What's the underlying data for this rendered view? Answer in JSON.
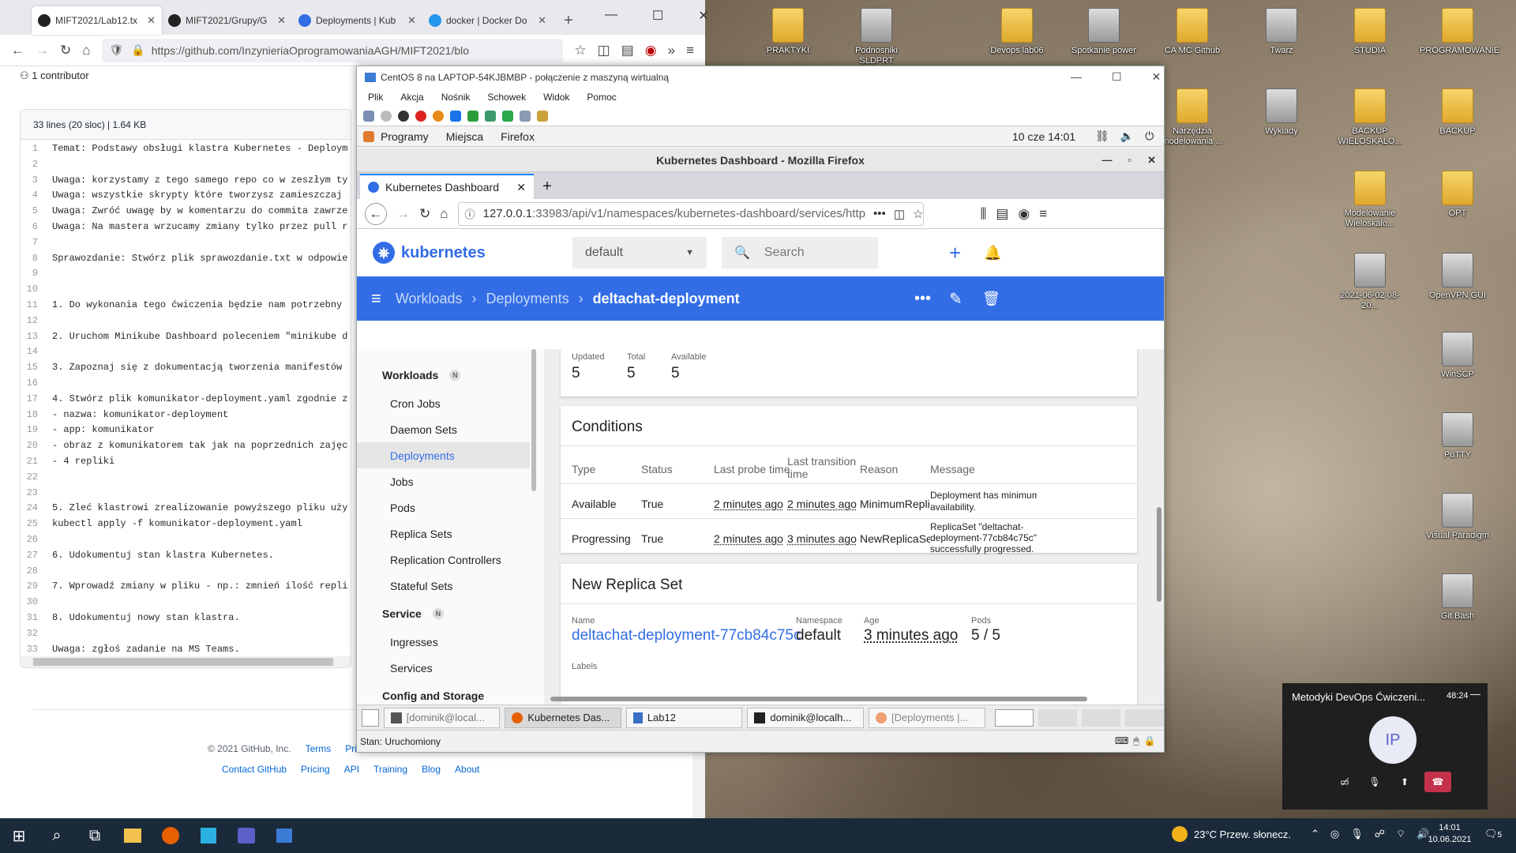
{
  "host_browser": {
    "tabs": [
      "MIFT2021/Lab12.tx",
      "MIFT2021/Grupy/G",
      "Deployments | Kub",
      "docker | Docker Do"
    ],
    "url": "https://github.com/InzynieriaOprogramowaniaAGH/MIFT2021/blo",
    "contributors": "1 contributor",
    "file_info": "33 lines (20 sloc)  |  1.64 KB",
    "lines": [
      {
        "n": "1",
        "t": "Temat: Podstawy obsługi klastra Kubernetes - Deploym"
      },
      {
        "n": "2",
        "t": ""
      },
      {
        "n": "3",
        "t": "Uwaga: korzystamy z tego samego repo co w zeszłym ty"
      },
      {
        "n": "4",
        "t": "Uwaga: wszystkie skrypty które tworzysz zamieszczaj"
      },
      {
        "n": "5",
        "t": "Uwaga: Zwróć uwagę by w komentarzu do commita zawrze"
      },
      {
        "n": "6",
        "t": "Uwaga: Na mastera wrzucamy zmiany tylko przez pull r"
      },
      {
        "n": "7",
        "t": ""
      },
      {
        "n": "8",
        "t": "Sprawozdanie: Stwórz plik sprawozdanie.txt w odpowie"
      },
      {
        "n": "9",
        "t": ""
      },
      {
        "n": "10",
        "t": ""
      },
      {
        "n": "11",
        "t": "1. Do wykonania tego ćwiczenia będzie nam potrzebny"
      },
      {
        "n": "12",
        "t": ""
      },
      {
        "n": "13",
        "t": "2. Uruchom Minikube Dashboard poleceniem \"minikube d"
      },
      {
        "n": "14",
        "t": ""
      },
      {
        "n": "15",
        "t": "3. Zapoznaj się z dokumentacją tworzenia manifestów"
      },
      {
        "n": "16",
        "t": ""
      },
      {
        "n": "17",
        "t": "4. Stwórz plik komunikator-deployment.yaml zgodnie z"
      },
      {
        "n": "18",
        "t": "- nazwa: komunikator-deployment"
      },
      {
        "n": "19",
        "t": "- app: komunikator"
      },
      {
        "n": "20",
        "t": "- obraz z komunikatorem tak jak na poprzednich zajęc"
      },
      {
        "n": "21",
        "t": "- 4 repliki"
      },
      {
        "n": "22",
        "t": ""
      },
      {
        "n": "23",
        "t": ""
      },
      {
        "n": "24",
        "t": "5. Zleć klastrowi zrealizowanie powyższego pliku uży"
      },
      {
        "n": "25",
        "t": "kubectl apply -f komunikator-deployment.yaml"
      },
      {
        "n": "26",
        "t": ""
      },
      {
        "n": "27",
        "t": "6. Udokumentuj stan klastra Kubernetes."
      },
      {
        "n": "28",
        "t": ""
      },
      {
        "n": "29",
        "t": "7. Wprowadź zmiany w pliku - np.: zmnień ilość repli"
      },
      {
        "n": "30",
        "t": ""
      },
      {
        "n": "31",
        "t": "8. Udokumentuj nowy stan klastra."
      },
      {
        "n": "32",
        "t": ""
      },
      {
        "n": "33",
        "t": "Uwaga: zgłoś zadanie na MS Teams."
      }
    ],
    "footer_copy": "© 2021 GitHub, Inc.",
    "footer_terms": "Terms",
    "footer_priv": "Priv",
    "footer_links": [
      "Contact GitHub",
      "Pricing",
      "API",
      "Training",
      "Blog",
      "About"
    ]
  },
  "vm": {
    "title": "CentOS 8 na LAPTOP-54KJBMBP - połączenie z maszyną wirtualną",
    "menu": [
      "Plik",
      "Akcja",
      "Nośnik",
      "Schowek",
      "Widok",
      "Pomoc"
    ],
    "gnome": {
      "items": [
        "Programy",
        "Miejsca",
        "Firefox"
      ],
      "clock": "10 cze  14:01"
    },
    "status": "Stan: Uruchomiony",
    "tasks": [
      "[dominik@local...",
      "Kubernetes Das...",
      "Lab12",
      "dominik@localh...",
      "[Deployments |..."
    ]
  },
  "guest_firefox": {
    "title": "Kubernetes Dashboard - Mozilla Firefox",
    "tab": "Kubernetes Dashboard",
    "url_host": "127.0.0.1",
    "url_rest": ":33983/api/v1/namespaces/kubernetes-dashboard/services/http"
  },
  "k8s": {
    "brand": "kubernetes",
    "namespace": "default",
    "search_placeholder": "Search",
    "breadcrumb": [
      "Workloads",
      "Deployments",
      "deltachat-deployment"
    ],
    "sidebar": {
      "workloads_hdr": "Workloads",
      "badge": "N",
      "workloads": [
        "Cron Jobs",
        "Daemon Sets",
        "Deployments",
        "Jobs",
        "Pods",
        "Replica Sets",
        "Replication Controllers",
        "Stateful Sets"
      ],
      "service_hdr": "Service",
      "service": [
        "Ingresses",
        "Services"
      ],
      "config_hdr": "Config and Storage"
    },
    "status": {
      "updated_lbl": "Updated",
      "updated": "5",
      "total_lbl": "Total",
      "total": "5",
      "available_lbl": "Available",
      "available": "5"
    },
    "conditions": {
      "title": "Conditions",
      "headers": {
        "type": "Type",
        "status": "Status",
        "probe": "Last probe time",
        "trans1": "Last transition",
        "trans2": "time",
        "reason": "Reason",
        "message": "Message"
      },
      "rows": [
        {
          "type": "Available",
          "status": "True",
          "probe": "2 minutes ago",
          "trans": "2 minutes ago",
          "reason": "MinimumReplicas",
          "msg1": "Deployment has minimum",
          "msg2": "availability.",
          "msg3": ""
        },
        {
          "type": "Progressing",
          "status": "True",
          "probe": "2 minutes ago",
          "trans": "3 minutes ago",
          "reason": "NewReplicaSetAv",
          "msg1": "ReplicaSet \"deltachat-",
          "msg2": "deployment-77cb84c75c\"",
          "msg3": "successfully progressed."
        }
      ]
    },
    "replica": {
      "title": "New Replica Set",
      "name_lbl": "Name",
      "name": "deltachat-deployment-77cb84c75c",
      "ns_lbl": "Namespace",
      "ns": "default",
      "age_lbl": "Age",
      "age": "3 minutes ago",
      "pods_lbl": "Pods",
      "pods": "5 / 5",
      "labels_lbl": "Labels"
    }
  },
  "desktop": {
    "icons": [
      "PRAKTYKI",
      "Podnosniki SLDPRT",
      "Devops lab06",
      "Spotkanie power",
      "CA MC Github",
      "Twarz",
      "STUDIA",
      "PROGRAMOWANIE",
      "Narzędzia modelowania ...",
      "Wyklady",
      "BACKUP WIELOSKALO...",
      "BACKUP",
      "Modelowanie Wieloskalo...",
      "OPT",
      "2021-06-02 08-20...",
      "OpenVPN GUI",
      "WinSCP",
      "PuTTY",
      "Visual Paradigm",
      "Git Bash"
    ]
  },
  "teams": {
    "title": "Metodyki DevOps Ćwiczeni...",
    "time": "48:24",
    "initials": "IP"
  },
  "taskbar": {
    "weather": "23°C  Przew. słonecz.",
    "time": "14:01",
    "date": "10.06.2021",
    "notif": "5"
  }
}
